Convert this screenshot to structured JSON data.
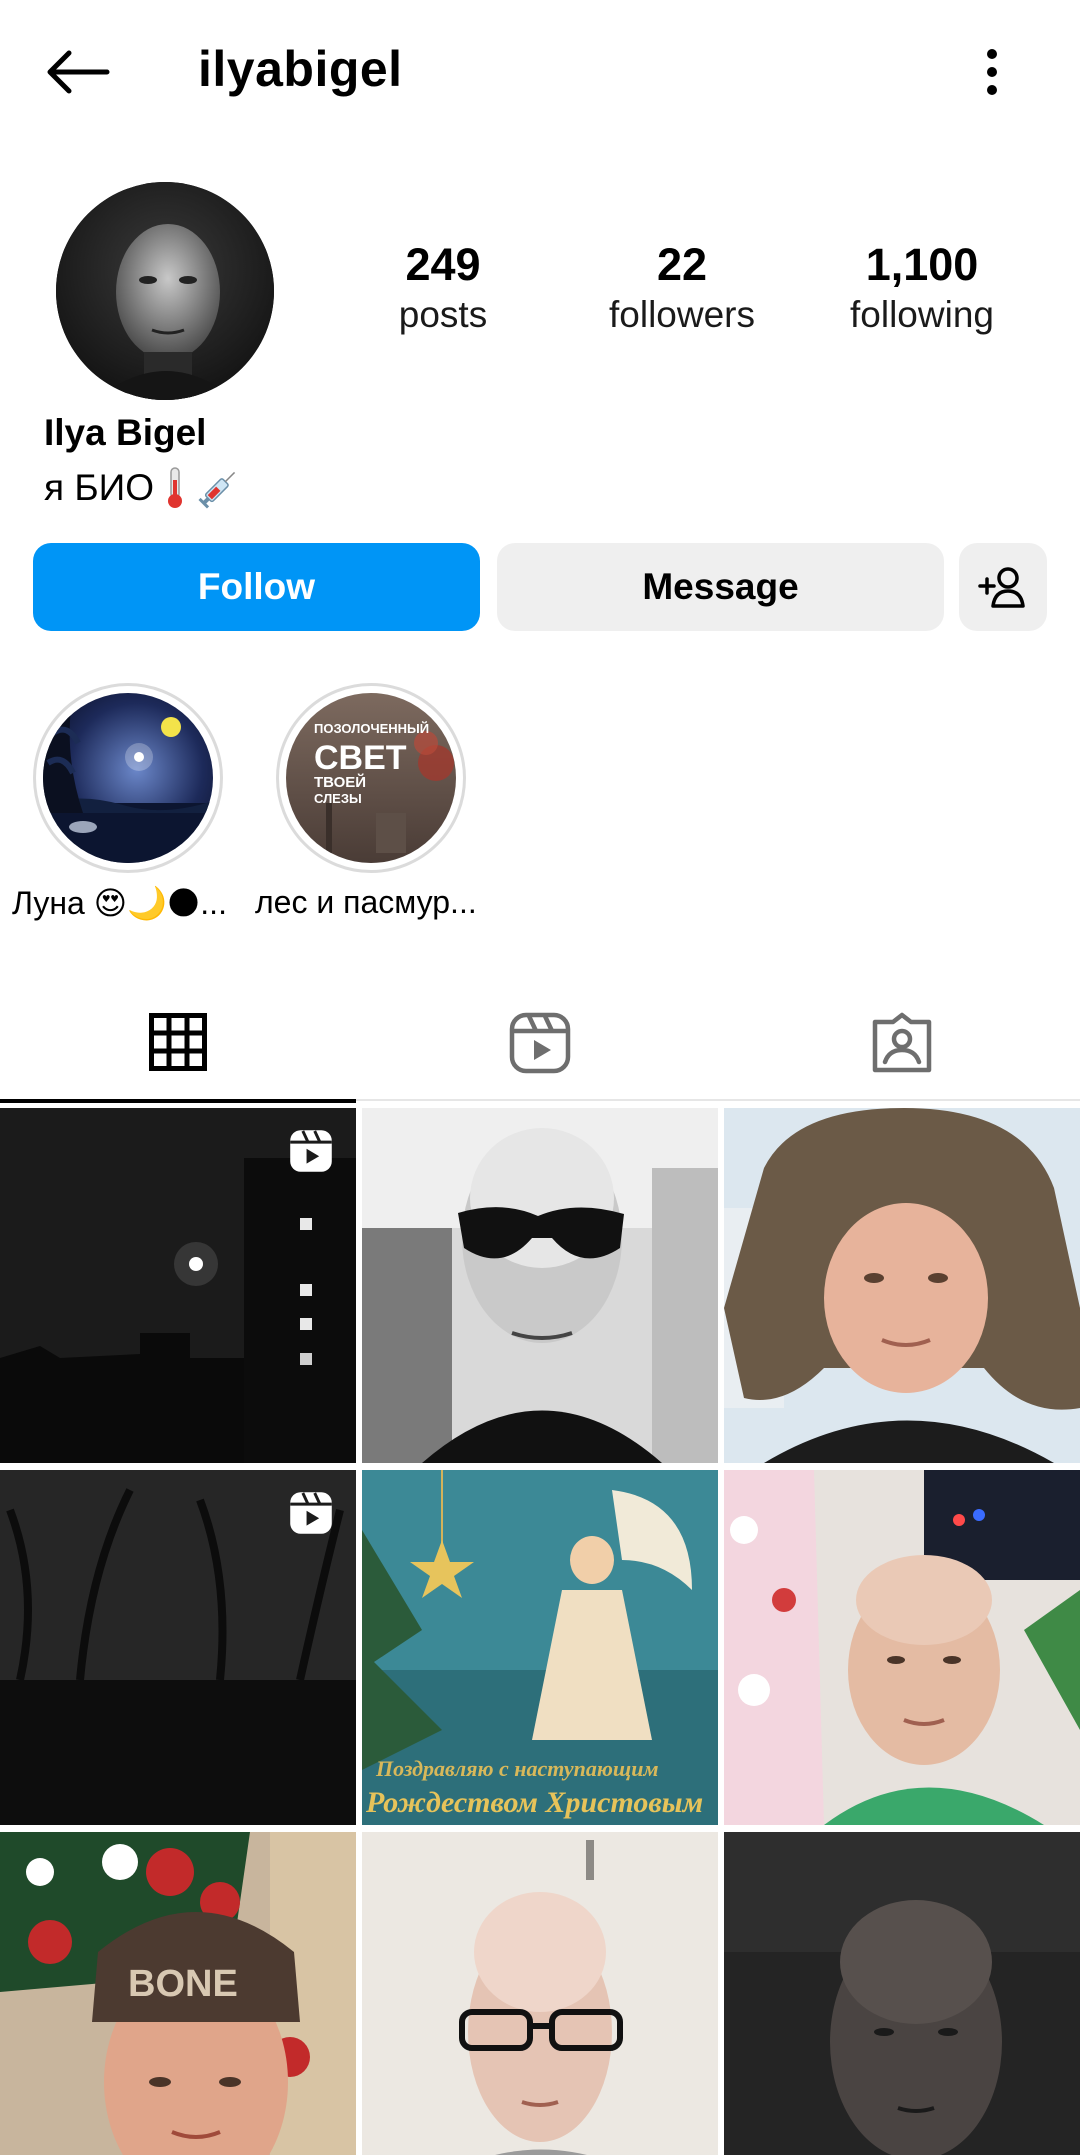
{
  "header": {
    "username": "ilyabigel",
    "back_icon": "arrow-left-icon",
    "more_icon": "more-vertical-icon"
  },
  "profile": {
    "full_name": "Ilya Bigel",
    "bio_text": "я БИО",
    "bio_emojis": [
      "thermometer-icon",
      "syringe-icon"
    ]
  },
  "stats": {
    "posts": {
      "value": "249",
      "label": "posts"
    },
    "followers": {
      "value": "22",
      "label": "followers"
    },
    "following": {
      "value": "1,100",
      "label": "following"
    }
  },
  "actions": {
    "follow_label": "Follow",
    "message_label": "Message",
    "add_user_icon": "add-user-icon"
  },
  "highlights": [
    {
      "label": "Луна 😍🌙🌑..."
    },
    {
      "label": "лес и пасмур...",
      "cover_text": [
        "ПОЗОЛОЧЕННЫЙ",
        "СВЕТ",
        "ТВОЕЙ",
        "СЛЕЗЫ"
      ]
    }
  ],
  "tabs": [
    {
      "name": "grid",
      "icon": "grid-icon",
      "active": true
    },
    {
      "name": "reels",
      "icon": "reels-icon",
      "active": false
    },
    {
      "name": "tagged",
      "icon": "tagged-icon",
      "active": false
    }
  ],
  "posts": [
    {
      "kind": "reel"
    },
    {
      "kind": "photo"
    },
    {
      "kind": "photo"
    },
    {
      "kind": "reel"
    },
    {
      "kind": "photo",
      "caption": [
        "Поздравляю с наступающим",
        "Рождеством Христовым"
      ]
    },
    {
      "kind": "photo"
    },
    {
      "kind": "photo",
      "hat_text": "BONE"
    },
    {
      "kind": "photo"
    },
    {
      "kind": "photo"
    }
  ],
  "colors": {
    "accent": "#0095f6",
    "secondary_button": "#efefef",
    "divider": "#dbdbdb"
  }
}
